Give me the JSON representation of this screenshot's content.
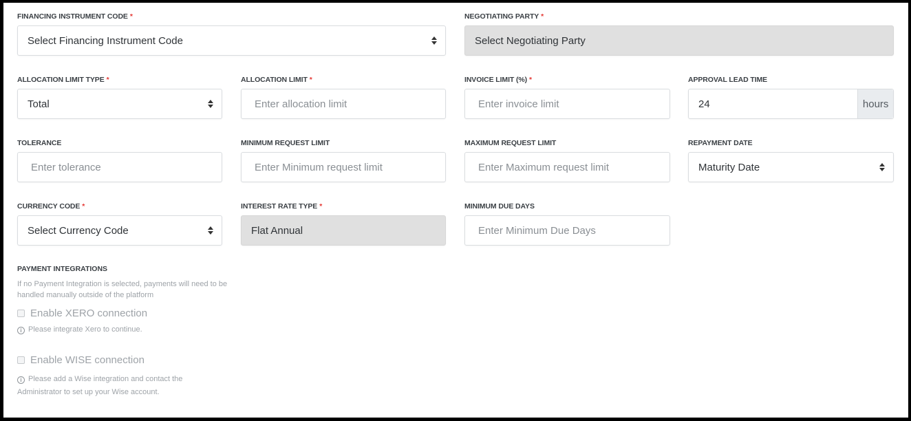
{
  "form": {
    "financing_instrument_code": {
      "label": "FINANCING INSTRUMENT CODE",
      "required": "*",
      "value": "Select Financing Instrument Code",
      "type": "select"
    },
    "negotiating_party": {
      "label": "NEGOTIATING PARTY",
      "required": "*",
      "value": "Select Negotiating Party",
      "type": "select-disabled"
    },
    "allocation_limit_type": {
      "label": "ALLOCATION LIMIT TYPE",
      "required": "*",
      "value": "Total",
      "type": "select"
    },
    "allocation_limit": {
      "label": "ALLOCATION LIMIT",
      "required": "*",
      "placeholder": "Enter allocation limit",
      "value": ""
    },
    "invoice_limit": {
      "label": "INVOICE LIMIT (%)",
      "required": "*",
      "placeholder": "Enter invoice limit",
      "value": ""
    },
    "approval_lead_time": {
      "label": "APPROVAL LEAD TIME",
      "value": "24",
      "addon": "hours"
    },
    "tolerance": {
      "label": "TOLERANCE",
      "placeholder": "Enter tolerance",
      "value": ""
    },
    "minimum_request_limit": {
      "label": "MINIMUM REQUEST LIMIT",
      "placeholder": "Enter Minimum request limit",
      "value": ""
    },
    "maximum_request_limit": {
      "label": "MAXIMUM REQUEST LIMIT",
      "placeholder": "Enter Maximum request limit",
      "value": ""
    },
    "repayment_date": {
      "label": "REPAYMENT DATE",
      "value": "Maturity Date",
      "type": "select"
    },
    "currency_code": {
      "label": "CURRENCY CODE",
      "required": "*",
      "value": "Select Currency Code",
      "type": "select"
    },
    "interest_rate_type": {
      "label": "INTEREST RATE TYPE",
      "required": "*",
      "value": "Flat Annual",
      "type": "disabled"
    },
    "minimum_due_days": {
      "label": "MINIMUM DUE DAYS",
      "placeholder": "Enter Minimum Due Days",
      "value": ""
    }
  },
  "payment_integrations": {
    "title": "PAYMENT INTEGRATIONS",
    "hint": "If no Payment Integration is selected, payments will need to be handled manually outside of the platform",
    "xero": {
      "label": "Enable XERO connection",
      "checked": false,
      "info_icon": "info-circle-icon",
      "info": "Please integrate Xero to continue."
    },
    "wise": {
      "label": "Enable WISE connection",
      "checked": false,
      "info_icon": "info-circle-icon",
      "info": "Please add a Wise integration and contact the Administrator to set up your Wise account."
    }
  },
  "colors": {
    "required_marker": "#e53935",
    "disabled_bg": "#e0e0e0",
    "addon_bg": "#e9ecef"
  }
}
